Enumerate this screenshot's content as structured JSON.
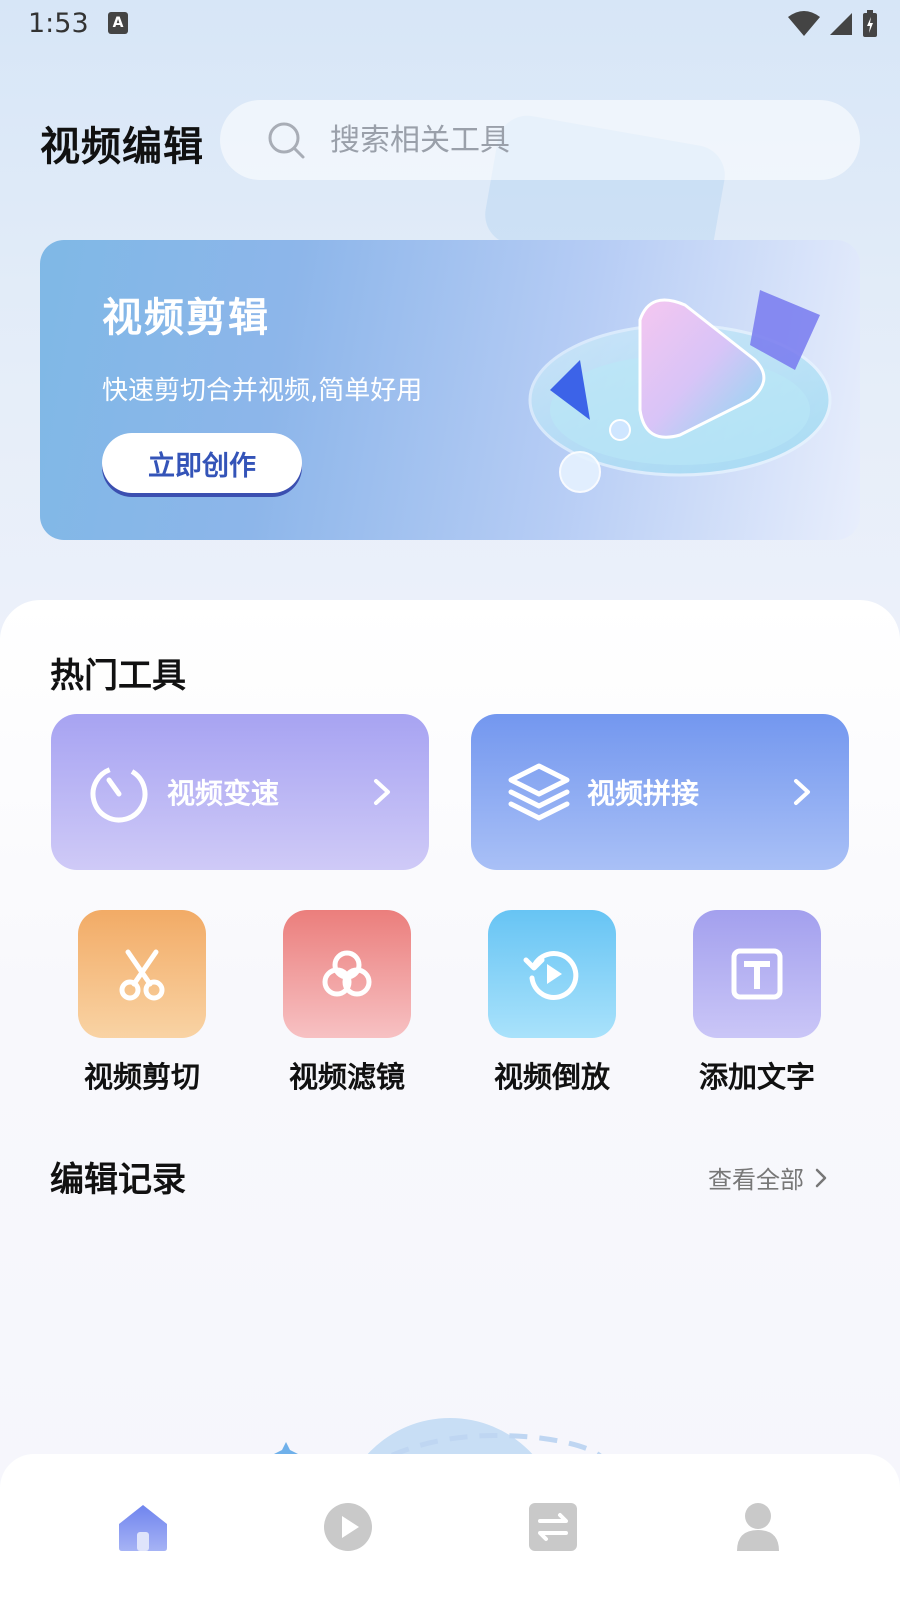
{
  "status_bar": {
    "time": "1:53",
    "a_glyph": "A"
  },
  "header": {
    "title": "视频编辑",
    "search_placeholder": "搜索相关工具"
  },
  "banner": {
    "title": "视频剪辑",
    "subtitle": "快速剪切合并视频,简单好用",
    "button_label": "立即创作"
  },
  "hot_tools": {
    "title": "热门工具",
    "items": [
      {
        "label": "视频变速",
        "icon": "timer-icon"
      },
      {
        "label": "视频拼接",
        "icon": "layers-icon"
      }
    ]
  },
  "tools": [
    {
      "label": "视频剪切",
      "icon": "scissors-icon",
      "color": "#f2ab66"
    },
    {
      "label": "视频滤镜",
      "icon": "filter-circles-icon",
      "color": "#eb7e7c"
    },
    {
      "label": "视频倒放",
      "icon": "reverse-play-icon",
      "color": "#67c4f4"
    },
    {
      "label": "添加文字",
      "icon": "text-icon",
      "color": "#a3a0ee"
    }
  ],
  "records": {
    "title": "编辑记录",
    "view_all": "查看全部"
  },
  "bottom_nav": [
    {
      "name": "home",
      "icon": "home-icon",
      "active": true
    },
    {
      "name": "play",
      "icon": "play-icon",
      "active": false
    },
    {
      "name": "convert",
      "icon": "swap-icon",
      "active": false
    },
    {
      "name": "profile",
      "icon": "user-icon",
      "active": false
    }
  ],
  "colors": {
    "accent": "#7a8cf0",
    "banner_button_text": "#3454b8",
    "inactive_nav": "#c9c9c9"
  }
}
